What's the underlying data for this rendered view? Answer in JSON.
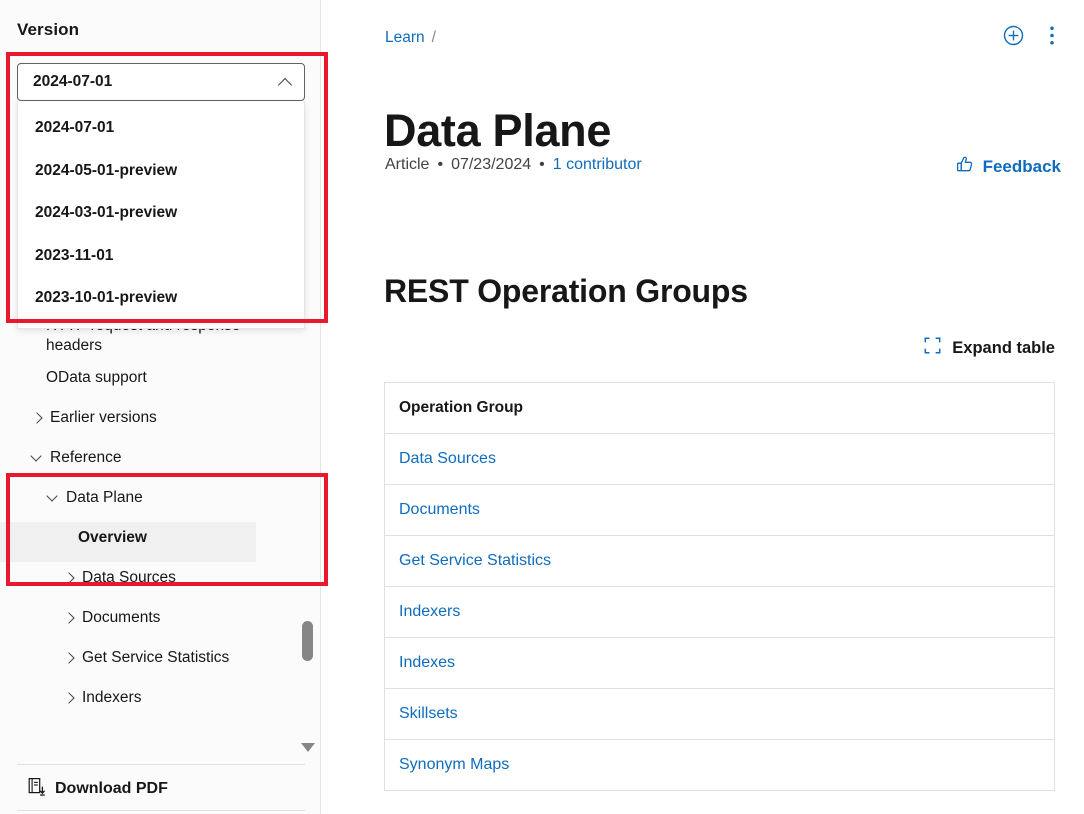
{
  "sidebar": {
    "version_label": "Version",
    "combobox": {
      "value": "2024-07-01",
      "chevron": "chevron-up-icon"
    },
    "options": [
      "2024-07-01",
      "2024-05-01-preview",
      "2024-03-01-preview",
      "2023-11-01",
      "2023-10-01-preview"
    ],
    "toc": [
      {
        "label": "HTTP request and response headers",
        "level": 2,
        "twisty": "none",
        "selected": false
      },
      {
        "label": "OData support",
        "level": 2,
        "twisty": "none",
        "selected": false
      },
      {
        "label": "Earlier versions",
        "level": 1,
        "twisty": "right",
        "selected": false
      },
      {
        "label": "Reference",
        "level": 1,
        "twisty": "down",
        "selected": false
      },
      {
        "label": "Data Plane",
        "level": 2,
        "twisty": "down",
        "selected": false
      },
      {
        "label": "Overview",
        "level": 3,
        "twisty": "none",
        "selected": true
      },
      {
        "label": "Data Sources",
        "level": 2,
        "twisty": "right",
        "selected": false
      },
      {
        "label": "Documents",
        "level": 2,
        "twisty": "right",
        "selected": false
      },
      {
        "label": "Get Service Statistics",
        "level": 2,
        "twisty": "right",
        "selected": false
      },
      {
        "label": "Indexers",
        "level": 2,
        "twisty": "right",
        "selected": false
      }
    ],
    "download_pdf": "Download PDF",
    "download_pdf_icon": "pdf-download-icon"
  },
  "main": {
    "breadcrumb": {
      "link": "Learn",
      "separator": "/"
    },
    "header_actions": [
      {
        "icon": "add-circle-icon"
      },
      {
        "icon": "more-vertical-icon"
      }
    ],
    "title": "Data Plane",
    "meta": {
      "type": "Article",
      "separator": "•",
      "date": "07/23/2024",
      "contributors": "1 contributor"
    },
    "feedback": {
      "label": "Feedback",
      "icon": "thumbs-up-icon"
    },
    "section_title": "REST Operation Groups",
    "expand_table": {
      "label": "Expand table",
      "icon": "expand-icon"
    },
    "table": {
      "columns": [
        "Operation Group"
      ],
      "rows": [
        [
          "Data Sources"
        ],
        [
          "Documents"
        ],
        [
          "Get Service Statistics"
        ],
        [
          "Indexers"
        ],
        [
          "Indexes"
        ],
        [
          "Skillsets"
        ],
        [
          "Synonym Maps"
        ]
      ]
    }
  },
  "annotations": [
    {
      "name": "version-dropdown-highlight",
      "color": "#e8192c"
    },
    {
      "name": "reference-section-highlight",
      "color": "#e8192c"
    }
  ],
  "colors": {
    "link_blue": "#0f6cbd",
    "annotation_red": "#e8192c",
    "selected_bg": "#f0f0f0",
    "border_gray": "#e0e0e0"
  }
}
